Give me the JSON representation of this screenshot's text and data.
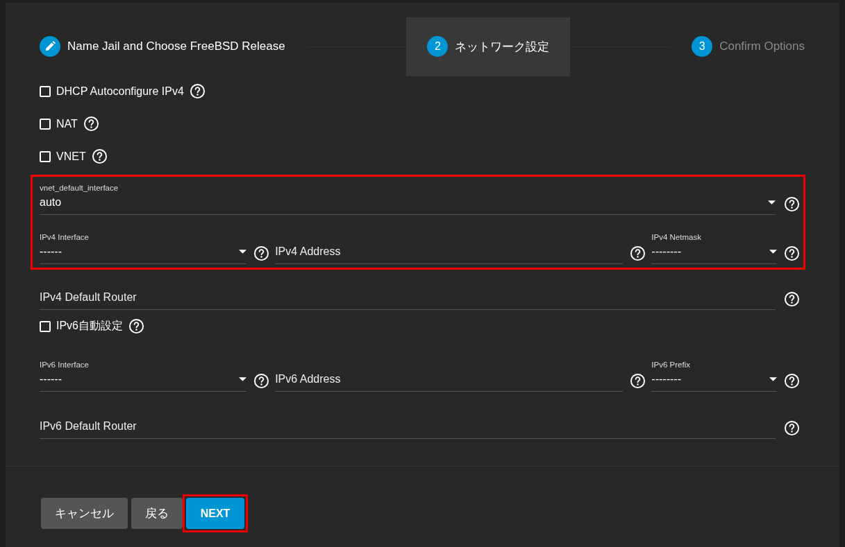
{
  "steps": [
    {
      "kind": "edit",
      "label": "Name Jail and Choose FreeBSD Release",
      "selected": false,
      "disabled": false
    },
    {
      "kind": "number",
      "number": "2",
      "label": "ネットワーク設定",
      "selected": true,
      "disabled": false
    },
    {
      "kind": "number",
      "number": "3",
      "label": "Confirm Options",
      "selected": false,
      "disabled": true
    }
  ],
  "form": [
    {
      "kind": "checkbox",
      "label": "DHCP Autoconfigure IPv4",
      "checked": false
    },
    {
      "kind": "checkbox",
      "label": "NAT",
      "checked": false
    },
    {
      "kind": "checkbox",
      "label": "VNET",
      "checked": false
    },
    {
      "kind": "group",
      "highlighted": true,
      "items": [
        {
          "kind": "select",
          "label": "vnet_default_interface",
          "value": "auto"
        },
        {
          "kind": "row",
          "fields": [
            {
              "kind": "select",
              "label": "IPv4 Interface",
              "value": "------"
            },
            {
              "kind": "input",
              "placeholder": "IPv4 Address"
            },
            {
              "kind": "select",
              "label": "IPv4 Netmask",
              "value": "--------"
            }
          ]
        }
      ]
    },
    {
      "kind": "input",
      "placeholder": "IPv4 Default Router"
    },
    {
      "kind": "checkbox",
      "label": "IPv6自動設定",
      "checked": false
    },
    {
      "kind": "row",
      "fields": [
        {
          "kind": "select",
          "label": "IPv6 Interface",
          "value": "------"
        },
        {
          "kind": "input",
          "placeholder": "IPv6 Address"
        },
        {
          "kind": "select",
          "label": "IPv6 Prefix",
          "value": "--------"
        }
      ]
    },
    {
      "kind": "input",
      "placeholder": "IPv6 Default Router"
    }
  ],
  "buttons": [
    {
      "label": "キャンセル",
      "kind": "secondary",
      "highlighted": false
    },
    {
      "label": "戻る",
      "kind": "secondary",
      "highlighted": false
    },
    {
      "label": "NEXT",
      "kind": "primary",
      "highlighted": true
    }
  ]
}
